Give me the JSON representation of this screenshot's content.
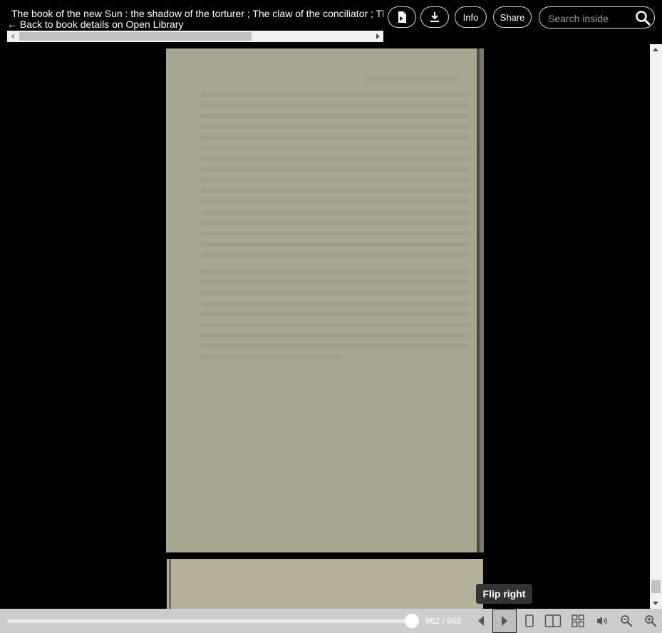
{
  "header": {
    "title": "The book of the new Sun : the shadow of the torturer ; The claw of the conciliator ; The sword of the lictor ; The citadel of the autarch",
    "back_link": "← Back to book details on Open Library"
  },
  "toolbar": {
    "info_label": "Info",
    "share_label": "Share",
    "search_placeholder": "Search inside",
    "icons": [
      "pdf-icon",
      "download-icon",
      "search-icon"
    ]
  },
  "reader": {
    "tooltip": "Flip right",
    "page_count": "962 / 968",
    "progress": 0.9938,
    "colors": {
      "page": "#a7a690",
      "nav_bar": "#cdcdcd",
      "tooltip": "#333333"
    },
    "nav_icons": [
      "flip-left-icon",
      "flip-right-icon",
      "one-page-view-icon",
      "two-page-view-icon",
      "thumbnail-view-icon",
      "read-aloud-icon",
      "zoom-out-icon",
      "zoom-in-icon"
    ]
  }
}
